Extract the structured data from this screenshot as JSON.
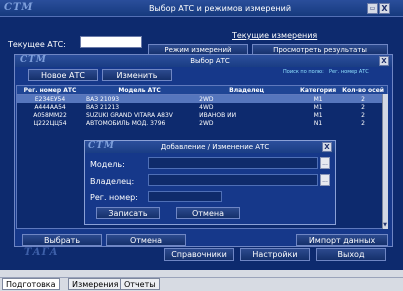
{
  "window": {
    "logo": "СТМ",
    "title": "Выбор АТС и режимов измерений",
    "close_glyph": "X",
    "current_ats_label": "Текущее АТС:",
    "current_ats_value": "",
    "link_current": "Текущие измерения",
    "bg_tab_left": "Режим измерений",
    "bg_tab_right": "Просмотреть результаты",
    "brand_bottom": "ТАГА"
  },
  "bottom_bar": {
    "buttons": [
      "Справочники",
      "Настройки",
      "Выход"
    ]
  },
  "status_tabs": [
    "Подготовка",
    "Измерения",
    "Отчеты"
  ],
  "select_dialog": {
    "logo": "СТМ",
    "title": "Выбор АТС",
    "close_glyph": "X",
    "new_button": "Новое АТС",
    "edit_button": "Изменить",
    "search_label": "Поиск по полю:",
    "search_field": "Рег. номер АТС",
    "columns": [
      "Рег. номер АТС",
      "Модель АТС",
      "Владелец",
      "Категория",
      "Кол-во осей"
    ],
    "rows": [
      [
        "Е234ЕУ54",
        "ВАЗ 21093",
        "2WD",
        "M1",
        "2"
      ],
      [
        "А444АА54",
        "ВАЗ 21213",
        "4WD",
        "M1",
        "2"
      ],
      [
        "А058ММ22",
        "SUZUKI GRAND VITARA A83V",
        "ИВАНОВ ИИ",
        "M1",
        "2"
      ],
      [
        "Ц222ЦЦ54",
        "АВТОМОБИЛЬ МОД. 3796",
        "2WD",
        "N1",
        "2"
      ]
    ],
    "select_button": "Выбрать",
    "cancel_button": "Отмена",
    "import_button": "Импорт данных"
  },
  "edit_dialog": {
    "logo": "СТМ",
    "title": "Добавление / Изменение АТС",
    "close_glyph": "X",
    "model_label": "Модель:",
    "owner_label": "Владелец:",
    "reg_label": "Рег. номер:",
    "model_value": "",
    "owner_value": "",
    "reg_value": "",
    "browse_glyph": "...",
    "save_button": "Записать",
    "cancel_button": "Отмена"
  },
  "colors": {
    "navy": "#0d2a6e",
    "panel": "#163a8a",
    "selected_row": "#5676bd",
    "light_panel": "#d7dbe3"
  }
}
